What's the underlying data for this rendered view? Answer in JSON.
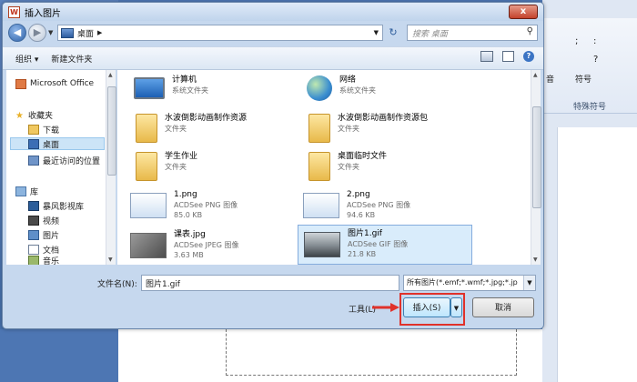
{
  "dialog": {
    "title": "插入图片",
    "close_label": "x"
  },
  "address": {
    "path": "桌面",
    "search_placeholder": "搜索 桌面"
  },
  "toolbar": {
    "organize": "组织 ▾",
    "new_folder": "新建文件夹"
  },
  "nav": {
    "items": [
      {
        "label": "Microsoft Office",
        "icon": "office-icon"
      },
      {
        "label": "收藏夹",
        "icon": "star-icon"
      },
      {
        "label": "下载",
        "icon": "download-folder-icon"
      },
      {
        "label": "桌面",
        "icon": "desktop-icon"
      },
      {
        "label": "最近访问的位置",
        "icon": "recent-places-icon"
      },
      {
        "label": "库",
        "icon": "library-icon"
      },
      {
        "label": "暴风影视库",
        "icon": "video-library-icon"
      },
      {
        "label": "视频",
        "icon": "video-icon"
      },
      {
        "label": "图片",
        "icon": "pictures-icon"
      },
      {
        "label": "文档",
        "icon": "documents-icon"
      },
      {
        "label": "音乐",
        "icon": "music-icon"
      }
    ]
  },
  "files": [
    {
      "name": "计算机",
      "type": "系统文件夹",
      "size": "",
      "icon": "computer-icon"
    },
    {
      "name": "网络",
      "type": "系统文件夹",
      "size": "",
      "icon": "network-icon"
    },
    {
      "name": "水波倒影动画制作资源",
      "type": "文件夹",
      "size": "",
      "icon": "folder-icon"
    },
    {
      "name": "水波倒影动画制作资源包",
      "type": "文件夹",
      "size": "",
      "icon": "folder-icon"
    },
    {
      "name": "学生作业",
      "type": "文件夹",
      "size": "",
      "icon": "folder-icon"
    },
    {
      "name": "桌面临时文件",
      "type": "文件夹",
      "size": "",
      "icon": "folder-icon"
    },
    {
      "name": "1.png",
      "type": "ACDSee PNG 图像",
      "size": "85.0 KB",
      "icon": "png-thumbnail-icon"
    },
    {
      "name": "2.png",
      "type": "ACDSee PNG 图像",
      "size": "94.6 KB",
      "icon": "png-thumbnail-icon"
    },
    {
      "name": "课表.jpg",
      "type": "ACDSee JPEG 图像",
      "size": "3.63 MB",
      "icon": "jpg-thumbnail-icon"
    },
    {
      "name": "图片1.gif",
      "type": "ACDSee GIF 图像",
      "size": "21.8 KB",
      "icon": "gif-thumbnail-icon"
    }
  ],
  "bottom": {
    "filename_label": "文件名(N):",
    "filename_value": "图片1.gif",
    "filetype_value": "所有图片(*.emf;*.wmf;*.jpg;*.jp",
    "tools": "工具(L)",
    "insert": "插入(S)",
    "cancel": "取消"
  },
  "background": {
    "ribbon_symbols": [
      ";",
      ":",
      "?",
      "符号"
    ],
    "group_label": "特殊符号",
    "side_label": "音"
  },
  "colors": {
    "accent": "#cce4f7",
    "highlight_red": "#e0322b",
    "insert_button": "#bee6fd"
  }
}
